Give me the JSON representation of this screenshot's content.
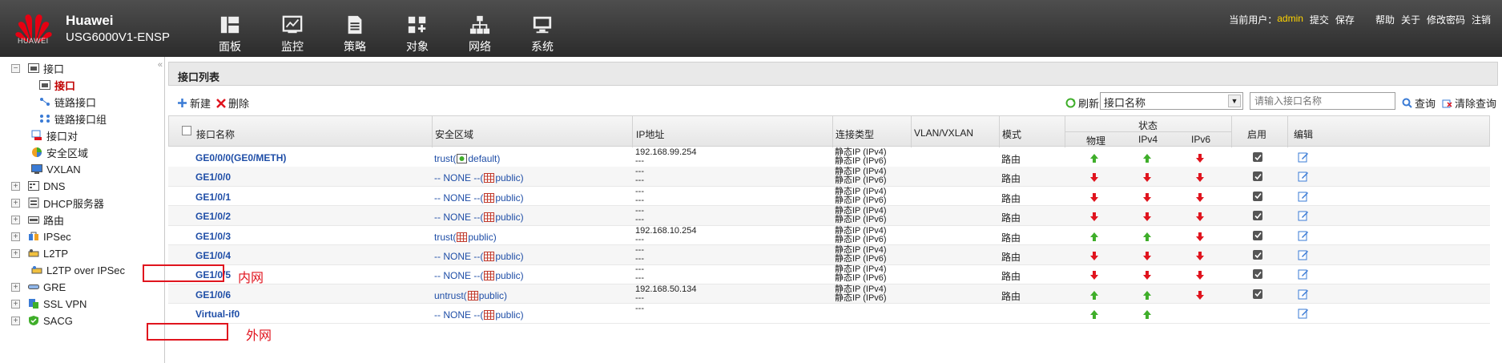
{
  "header": {
    "brand": "Huawei",
    "model": "USG6000V1-ENSP",
    "logo_text": "HUAWEI",
    "nav": [
      {
        "label": "面板",
        "icon": "dashboard-icon"
      },
      {
        "label": "监控",
        "icon": "monitor-icon"
      },
      {
        "label": "策略",
        "icon": "policy-icon"
      },
      {
        "label": "对象",
        "icon": "object-icon"
      },
      {
        "label": "网络",
        "icon": "network-icon"
      },
      {
        "label": "系统",
        "icon": "system-icon"
      }
    ],
    "user_label": "当前用户：",
    "user": "admin",
    "links": [
      "提交",
      "保存",
      "帮助",
      "关于",
      "修改密码",
      "注销"
    ]
  },
  "sidebar": {
    "items": [
      {
        "label": "接口",
        "expander": "−",
        "icon": "interface-icon"
      },
      {
        "label": "接口",
        "icon": "interface-icon",
        "selected": true
      },
      {
        "label": "链路接口",
        "icon": "link-icon"
      },
      {
        "label": "链路接口组",
        "icon": "link-group-icon"
      },
      {
        "label": "接口对",
        "icon": "interface-pair-icon"
      },
      {
        "label": "安全区域",
        "icon": "zone-icon"
      },
      {
        "label": "VXLAN",
        "icon": "vxlan-icon"
      },
      {
        "label": "DNS",
        "expander": "+",
        "icon": "dns-icon"
      },
      {
        "label": "DHCP服务器",
        "expander": "+",
        "icon": "dhcp-icon"
      },
      {
        "label": "路由",
        "expander": "+",
        "icon": "route-icon"
      },
      {
        "label": "IPSec",
        "expander": "+",
        "icon": "ipsec-icon"
      },
      {
        "label": "L2TP",
        "expander": "+",
        "icon": "l2tp-icon"
      },
      {
        "label": "L2TP over IPSec",
        "icon": "l2tp-ipsec-icon"
      },
      {
        "label": "GRE",
        "expander": "+",
        "icon": "gre-icon"
      },
      {
        "label": "SSL VPN",
        "expander": "+",
        "icon": "sslvpn-icon"
      },
      {
        "label": "SACG",
        "expander": "+",
        "icon": "sacg-icon"
      }
    ]
  },
  "panel": {
    "title": "接口列表",
    "toolbar": {
      "new_label": "新建",
      "delete_label": "删除",
      "refresh_label": "刷新",
      "filter_selected": "接口名称",
      "search_placeholder": "请输入接口名称",
      "query_label": "查询",
      "clear_label": "清除查询"
    }
  },
  "table": {
    "headers": {
      "name": "接口名称",
      "zone": "安全区域",
      "ip": "IP地址",
      "conn": "连接类型",
      "vlan": "VLAN/VXLAN",
      "mode": "模式",
      "status": "状态",
      "phys": "物理",
      "ipv4": "IPv4",
      "ipv6": "IPv6",
      "enable": "启用",
      "edit": "编辑"
    },
    "rows": [
      {
        "name": "GE0/0/0(GE0/METH)",
        "zone_prefix": "trust(",
        "zone_suffix": "default)",
        "ip1": "192.168.99.254",
        "ip2": "---",
        "conn1": "静态IP (IPv4)",
        "conn2": "静态IP (IPv6)",
        "mode": "路由",
        "phys": "up",
        "ipv4": "up",
        "ipv6": "down",
        "enabled": true
      },
      {
        "name": "GE1/0/0",
        "zone_prefix": "-- NONE --(",
        "zone_suffix": "public)",
        "ip1": "---",
        "ip2": "---",
        "conn1": "静态IP (IPv4)",
        "conn2": "静态IP (IPv6)",
        "mode": "路由",
        "phys": "down",
        "ipv4": "down",
        "ipv6": "down",
        "enabled": true
      },
      {
        "name": "GE1/0/1",
        "zone_prefix": "-- NONE --(",
        "zone_suffix": "public)",
        "ip1": "---",
        "ip2": "---",
        "conn1": "静态IP (IPv4)",
        "conn2": "静态IP (IPv6)",
        "mode": "路由",
        "phys": "down",
        "ipv4": "down",
        "ipv6": "down",
        "enabled": true
      },
      {
        "name": "GE1/0/2",
        "zone_prefix": "-- NONE --(",
        "zone_suffix": "public)",
        "ip1": "---",
        "ip2": "---",
        "conn1": "静态IP (IPv4)",
        "conn2": "静态IP (IPv6)",
        "mode": "路由",
        "phys": "down",
        "ipv4": "down",
        "ipv6": "down",
        "enabled": true
      },
      {
        "name": "GE1/0/3",
        "zone_prefix": "trust(",
        "zone_suffix": "public)",
        "ip1": "192.168.10.254",
        "ip2": "---",
        "conn1": "静态IP (IPv4)",
        "conn2": "静态IP (IPv6)",
        "mode": "路由",
        "phys": "up",
        "ipv4": "up",
        "ipv6": "down",
        "enabled": true
      },
      {
        "name": "GE1/0/4",
        "zone_prefix": "-- NONE --(",
        "zone_suffix": "public)",
        "ip1": "---",
        "ip2": "---",
        "conn1": "静态IP (IPv4)",
        "conn2": "静态IP (IPv6)",
        "mode": "路由",
        "phys": "down",
        "ipv4": "down",
        "ipv6": "down",
        "enabled": true
      },
      {
        "name": "GE1/0/5",
        "zone_prefix": "-- NONE --(",
        "zone_suffix": "public)",
        "ip1": "---",
        "ip2": "---",
        "conn1": "静态IP (IPv4)",
        "conn2": "静态IP (IPv6)",
        "mode": "路由",
        "phys": "down",
        "ipv4": "down",
        "ipv6": "down",
        "enabled": true
      },
      {
        "name": "GE1/0/6",
        "zone_prefix": "untrust(",
        "zone_suffix": "public)",
        "ip1": "192.168.50.134",
        "ip2": "---",
        "conn1": "静态IP (IPv4)",
        "conn2": "静态IP (IPv6)",
        "mode": "路由",
        "phys": "up",
        "ipv4": "up",
        "ipv6": "down",
        "enabled": true
      },
      {
        "name": "Virtual-if0",
        "zone_prefix": "-- NONE --(",
        "zone_suffix": "public)",
        "ip1": "---",
        "ip2": "",
        "conn1": "",
        "conn2": "",
        "mode": "",
        "phys": "up",
        "ipv4": "up",
        "ipv6": "",
        "enabled": false
      }
    ]
  },
  "annotations": [
    {
      "text": "内网",
      "row": 4
    },
    {
      "text": "外网",
      "row": 7
    }
  ],
  "colors": {
    "up": "#3fae2a",
    "down": "#e0141e",
    "link": "#1f4ea7",
    "annotation": "#e0141e"
  }
}
